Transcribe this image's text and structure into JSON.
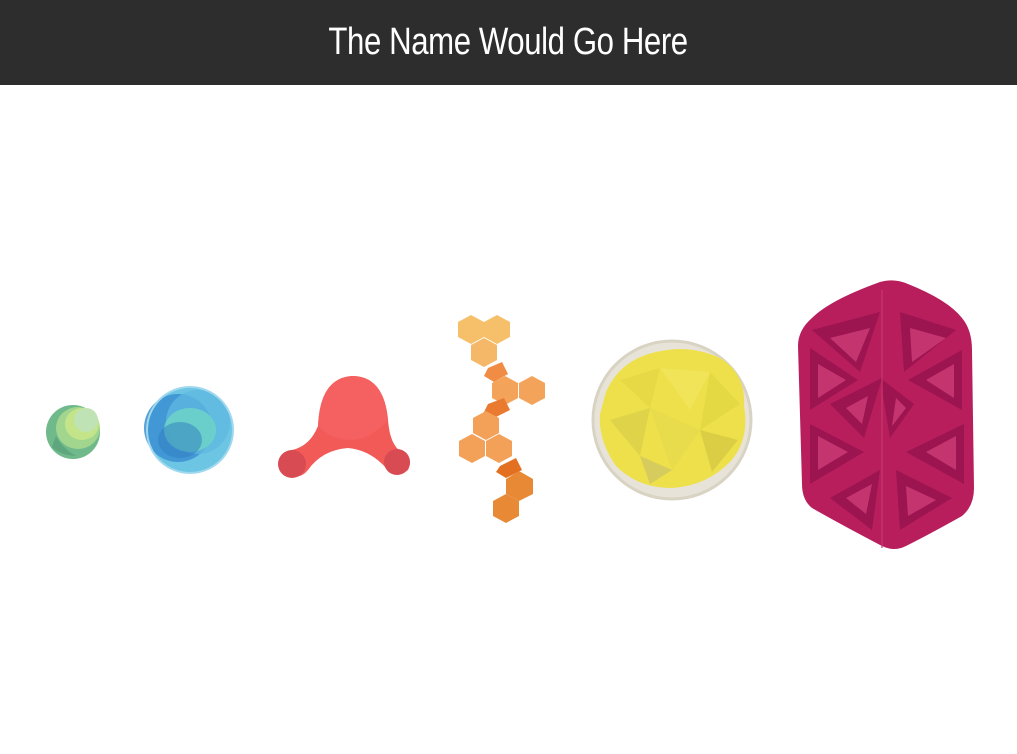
{
  "header": {
    "title": "The Name Would Go Here"
  },
  "colors": {
    "header_bg": "#2d2d2d",
    "green": "#7cc493",
    "blue": "#3a8fd1",
    "coral": "#f05a5a",
    "orange": "#f09a4a",
    "yellow": "#ede04a",
    "magenta": "#b81e5c"
  },
  "shapes": [
    {
      "name": "green-sphere-icon"
    },
    {
      "name": "blue-sphere-icon"
    },
    {
      "name": "coral-blob-icon"
    },
    {
      "name": "orange-hexagon-chain-icon"
    },
    {
      "name": "yellow-sphere-icon"
    },
    {
      "name": "magenta-triangle-cell-icon"
    }
  ]
}
